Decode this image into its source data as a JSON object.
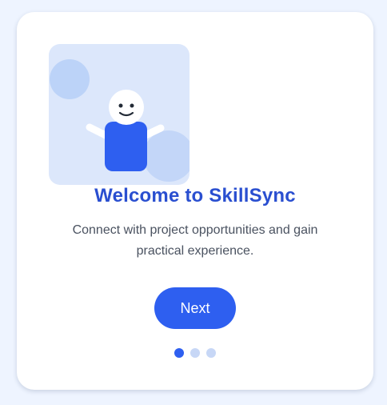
{
  "onboarding": {
    "title": "Welcome to SkillSync",
    "description": "Connect with project opportunities and gain practical experience.",
    "next_label": "Next",
    "step_current": 1,
    "step_total": 3
  },
  "colors": {
    "accent": "#2e5ff0",
    "title": "#2a4fd0",
    "background": "#eef4ff",
    "illustration_bg": "#dce7fb",
    "dot_inactive": "#c7d7f6"
  },
  "icons": {
    "illustration": "person-waving-illustration"
  }
}
